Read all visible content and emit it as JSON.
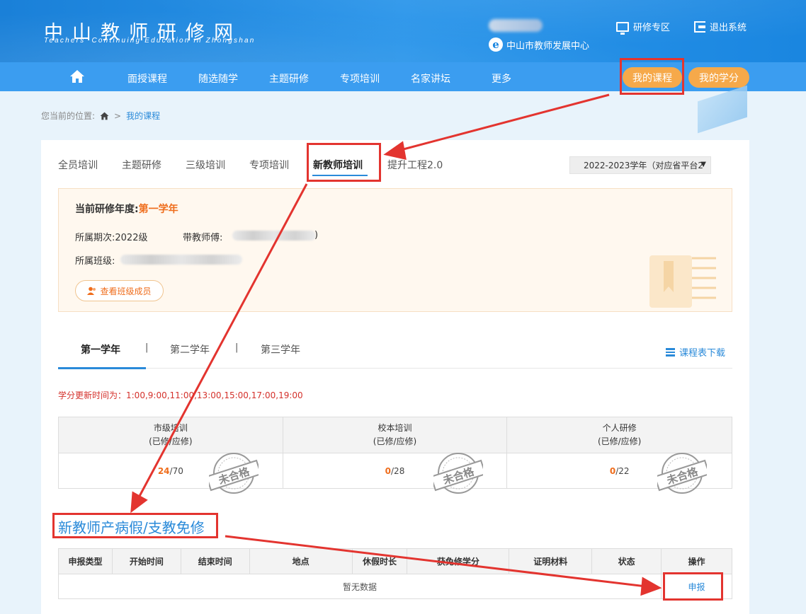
{
  "header": {
    "logo_cn": "中山教师研修网",
    "logo_en": "Teachers' Continuing Education in Zhongshan",
    "org": "中山市教师发展中心",
    "study_zone": "研修专区",
    "logout": "退出系统"
  },
  "nav": {
    "items": [
      "面授课程",
      "随选随学",
      "主题研修",
      "专项培训",
      "名家讲坛",
      "更多"
    ],
    "my_courses": "我的课程",
    "my_credits": "我的学分"
  },
  "breadcrumb": {
    "label": "您当前的位置:",
    "sep": ">",
    "current": "我的课程"
  },
  "tabs": [
    "全员培训",
    "主题研修",
    "三级培训",
    "专项培训",
    "新教师培训",
    "提升工程2.0"
  ],
  "year_select": "2022-2023学年（对应省平台2",
  "info": {
    "current_year_label": "当前研修年度:",
    "current_year_value": "第一学年",
    "period_label": "所属期次:",
    "period_value": "2022级",
    "mentor_label": "带教师傅:",
    "mentor_tail": ")",
    "class_label": "所属班级:",
    "members_button": "查看班级成员"
  },
  "year_tabs": {
    "items": [
      "第一学年",
      "第二学年",
      "第三学年"
    ],
    "separator": "|",
    "download": "课程表下载"
  },
  "update_note": "学分更新时间为：1:00,9:00,11:00,13:00,15:00,17:00,19:00",
  "score_table": {
    "columns": [
      {
        "title": "市级培训",
        "sub": "(已修/应修)",
        "done": "24",
        "required": "/70"
      },
      {
        "title": "校本培训",
        "sub": "(已修/应修)",
        "done": "0",
        "required": "/28"
      },
      {
        "title": "个人研修",
        "sub": "(已修/应修)",
        "done": "0",
        "required": "/22"
      }
    ],
    "stamp_text": "未合格"
  },
  "leave_section": {
    "title": "新教师产病假/支教免修",
    "headers": [
      "申报类型",
      "开始时间",
      "结束时间",
      "地点",
      "休假时长",
      "获免修学分",
      "证明材料",
      "状态",
      "操作"
    ],
    "empty_text": "暂无数据",
    "apply_button": "申报"
  },
  "colors": {
    "accent": "#2a8ad9",
    "orange": "#ef6d1c",
    "annotation_red": "#e3342f",
    "pill": "#f6a94a"
  }
}
